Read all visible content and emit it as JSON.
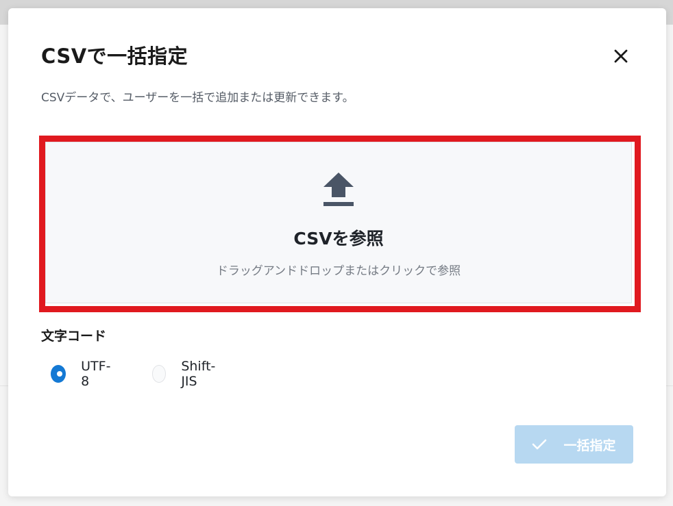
{
  "dialog": {
    "title": "CSVで一括指定",
    "description": "CSVデータで、ユーザーを一括で追加または更新できます。",
    "close_icon": "close-icon"
  },
  "dropzone": {
    "icon": "upload-icon",
    "title": "CSVを参照",
    "subtitle": "ドラッグアンドドロップまたはクリックで参照",
    "highlight_color": "#e0191f"
  },
  "encoding": {
    "label": "文字コード",
    "options": [
      {
        "label": "UTF-8",
        "selected": true
      },
      {
        "label": "Shift-JIS",
        "selected": false
      }
    ]
  },
  "submit": {
    "icon": "check-icon",
    "label": "一括指定",
    "disabled": true,
    "color": "#b7d8f1"
  },
  "colors": {
    "accent": "#1479d4"
  }
}
